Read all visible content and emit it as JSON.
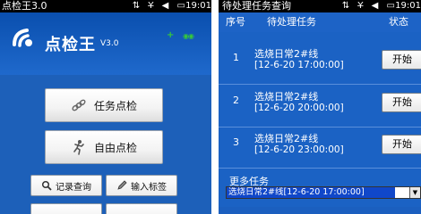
{
  "left": {
    "status": {
      "title": "点检王3.0",
      "icons": "⇅ Y̶ ◀ ▭",
      "time": "19:01"
    },
    "logo": {
      "name": "点检王",
      "version": "V3.0"
    },
    "indicators": {
      "plus": "+",
      "link": "◉◉"
    },
    "buttons": {
      "task_check": "任务点检",
      "free_check": "自由点检",
      "record_query": "记录查询",
      "input_label": "输入标签",
      "partial_1": "",
      "partial_2": ""
    },
    "icons": {
      "task_check": "chain-link-icon",
      "free_check": "running-man-icon",
      "record_query": "magnifier-icon",
      "input_label": "pencil-icon"
    },
    "colors": {
      "background": "#1c5fb8",
      "accent_green": "#36c83a"
    }
  },
  "right": {
    "status": {
      "title": "待处理任务查询",
      "icons": "⇅ Y̶ ◀ ▭",
      "time": "19:01"
    },
    "table": {
      "headers": {
        "seq": "序号",
        "task": "待处理任务",
        "state": "状态"
      },
      "rows": [
        {
          "seq": "1",
          "name": "选烧日常2#线",
          "time": "[12-6-20 17:00:00]",
          "action": "开始"
        },
        {
          "seq": "2",
          "name": "选烧日常2#线",
          "time": "[12-6-20 20:00:00]",
          "action": "开始"
        },
        {
          "seq": "3",
          "name": "选烧日常2#线",
          "time": "[12-6-20 23:00:00]",
          "action": "开始"
        }
      ]
    },
    "more": {
      "label": "更多任务",
      "selected": "选烧日常2#线[12-6-20 17:00:00]"
    },
    "colors": {
      "background": "#1b62c4",
      "selection": "#1047c9"
    }
  }
}
